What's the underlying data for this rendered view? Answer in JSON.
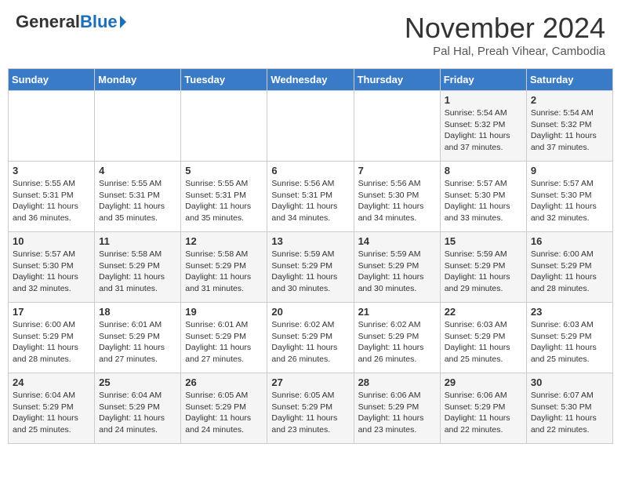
{
  "header": {
    "logo_general": "General",
    "logo_blue": "Blue",
    "month_title": "November 2024",
    "location": "Pal Hal, Preah Vihear, Cambodia"
  },
  "days_of_week": [
    "Sunday",
    "Monday",
    "Tuesday",
    "Wednesday",
    "Thursday",
    "Friday",
    "Saturday"
  ],
  "weeks": [
    [
      {
        "num": "",
        "info": ""
      },
      {
        "num": "",
        "info": ""
      },
      {
        "num": "",
        "info": ""
      },
      {
        "num": "",
        "info": ""
      },
      {
        "num": "",
        "info": ""
      },
      {
        "num": "1",
        "info": "Sunrise: 5:54 AM\nSunset: 5:32 PM\nDaylight: 11 hours and 37 minutes."
      },
      {
        "num": "2",
        "info": "Sunrise: 5:54 AM\nSunset: 5:32 PM\nDaylight: 11 hours and 37 minutes."
      }
    ],
    [
      {
        "num": "3",
        "info": "Sunrise: 5:55 AM\nSunset: 5:31 PM\nDaylight: 11 hours and 36 minutes."
      },
      {
        "num": "4",
        "info": "Sunrise: 5:55 AM\nSunset: 5:31 PM\nDaylight: 11 hours and 35 minutes."
      },
      {
        "num": "5",
        "info": "Sunrise: 5:55 AM\nSunset: 5:31 PM\nDaylight: 11 hours and 35 minutes."
      },
      {
        "num": "6",
        "info": "Sunrise: 5:56 AM\nSunset: 5:31 PM\nDaylight: 11 hours and 34 minutes."
      },
      {
        "num": "7",
        "info": "Sunrise: 5:56 AM\nSunset: 5:30 PM\nDaylight: 11 hours and 34 minutes."
      },
      {
        "num": "8",
        "info": "Sunrise: 5:57 AM\nSunset: 5:30 PM\nDaylight: 11 hours and 33 minutes."
      },
      {
        "num": "9",
        "info": "Sunrise: 5:57 AM\nSunset: 5:30 PM\nDaylight: 11 hours and 32 minutes."
      }
    ],
    [
      {
        "num": "10",
        "info": "Sunrise: 5:57 AM\nSunset: 5:30 PM\nDaylight: 11 hours and 32 minutes."
      },
      {
        "num": "11",
        "info": "Sunrise: 5:58 AM\nSunset: 5:29 PM\nDaylight: 11 hours and 31 minutes."
      },
      {
        "num": "12",
        "info": "Sunrise: 5:58 AM\nSunset: 5:29 PM\nDaylight: 11 hours and 31 minutes."
      },
      {
        "num": "13",
        "info": "Sunrise: 5:59 AM\nSunset: 5:29 PM\nDaylight: 11 hours and 30 minutes."
      },
      {
        "num": "14",
        "info": "Sunrise: 5:59 AM\nSunset: 5:29 PM\nDaylight: 11 hours and 30 minutes."
      },
      {
        "num": "15",
        "info": "Sunrise: 5:59 AM\nSunset: 5:29 PM\nDaylight: 11 hours and 29 minutes."
      },
      {
        "num": "16",
        "info": "Sunrise: 6:00 AM\nSunset: 5:29 PM\nDaylight: 11 hours and 28 minutes."
      }
    ],
    [
      {
        "num": "17",
        "info": "Sunrise: 6:00 AM\nSunset: 5:29 PM\nDaylight: 11 hours and 28 minutes."
      },
      {
        "num": "18",
        "info": "Sunrise: 6:01 AM\nSunset: 5:29 PM\nDaylight: 11 hours and 27 minutes."
      },
      {
        "num": "19",
        "info": "Sunrise: 6:01 AM\nSunset: 5:29 PM\nDaylight: 11 hours and 27 minutes."
      },
      {
        "num": "20",
        "info": "Sunrise: 6:02 AM\nSunset: 5:29 PM\nDaylight: 11 hours and 26 minutes."
      },
      {
        "num": "21",
        "info": "Sunrise: 6:02 AM\nSunset: 5:29 PM\nDaylight: 11 hours and 26 minutes."
      },
      {
        "num": "22",
        "info": "Sunrise: 6:03 AM\nSunset: 5:29 PM\nDaylight: 11 hours and 25 minutes."
      },
      {
        "num": "23",
        "info": "Sunrise: 6:03 AM\nSunset: 5:29 PM\nDaylight: 11 hours and 25 minutes."
      }
    ],
    [
      {
        "num": "24",
        "info": "Sunrise: 6:04 AM\nSunset: 5:29 PM\nDaylight: 11 hours and 25 minutes."
      },
      {
        "num": "25",
        "info": "Sunrise: 6:04 AM\nSunset: 5:29 PM\nDaylight: 11 hours and 24 minutes."
      },
      {
        "num": "26",
        "info": "Sunrise: 6:05 AM\nSunset: 5:29 PM\nDaylight: 11 hours and 24 minutes."
      },
      {
        "num": "27",
        "info": "Sunrise: 6:05 AM\nSunset: 5:29 PM\nDaylight: 11 hours and 23 minutes."
      },
      {
        "num": "28",
        "info": "Sunrise: 6:06 AM\nSunset: 5:29 PM\nDaylight: 11 hours and 23 minutes."
      },
      {
        "num": "29",
        "info": "Sunrise: 6:06 AM\nSunset: 5:29 PM\nDaylight: 11 hours and 22 minutes."
      },
      {
        "num": "30",
        "info": "Sunrise: 6:07 AM\nSunset: 5:30 PM\nDaylight: 11 hours and 22 minutes."
      }
    ]
  ]
}
